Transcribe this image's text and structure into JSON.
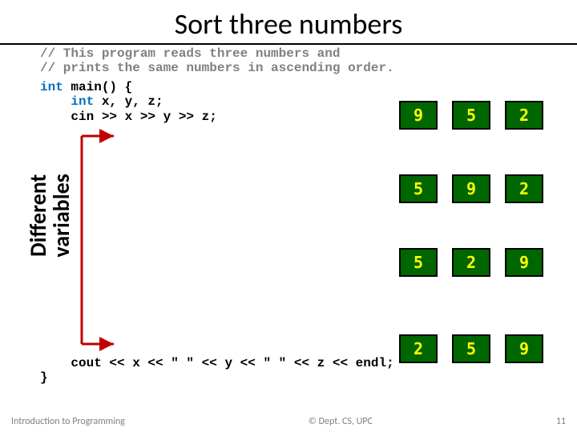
{
  "title": "Sort three numbers",
  "code": {
    "comment1": "// This program reads three numbers and",
    "comment2": "// prints the same numbers in ascending order.",
    "kw_int": "int",
    "main_sig": " main() {",
    "indent": "    ",
    "decl": " x, y, z;",
    "cin": "    cin >> x >> y >> z;",
    "cout": "    cout << x << \" \" << y << \" \" << z << endl;",
    "close": "}"
  },
  "boxes": {
    "row1": [
      "9",
      "5",
      "2"
    ],
    "row2": [
      "5",
      "9",
      "2"
    ],
    "row3": [
      "5",
      "2",
      "9"
    ],
    "row4": [
      "2",
      "5",
      "9"
    ]
  },
  "sidelabel_l1": "Different",
  "sidelabel_l2": "variables",
  "footer": {
    "left": "Introduction to Programming",
    "center": "© Dept. CS, UPC",
    "right": "11"
  }
}
